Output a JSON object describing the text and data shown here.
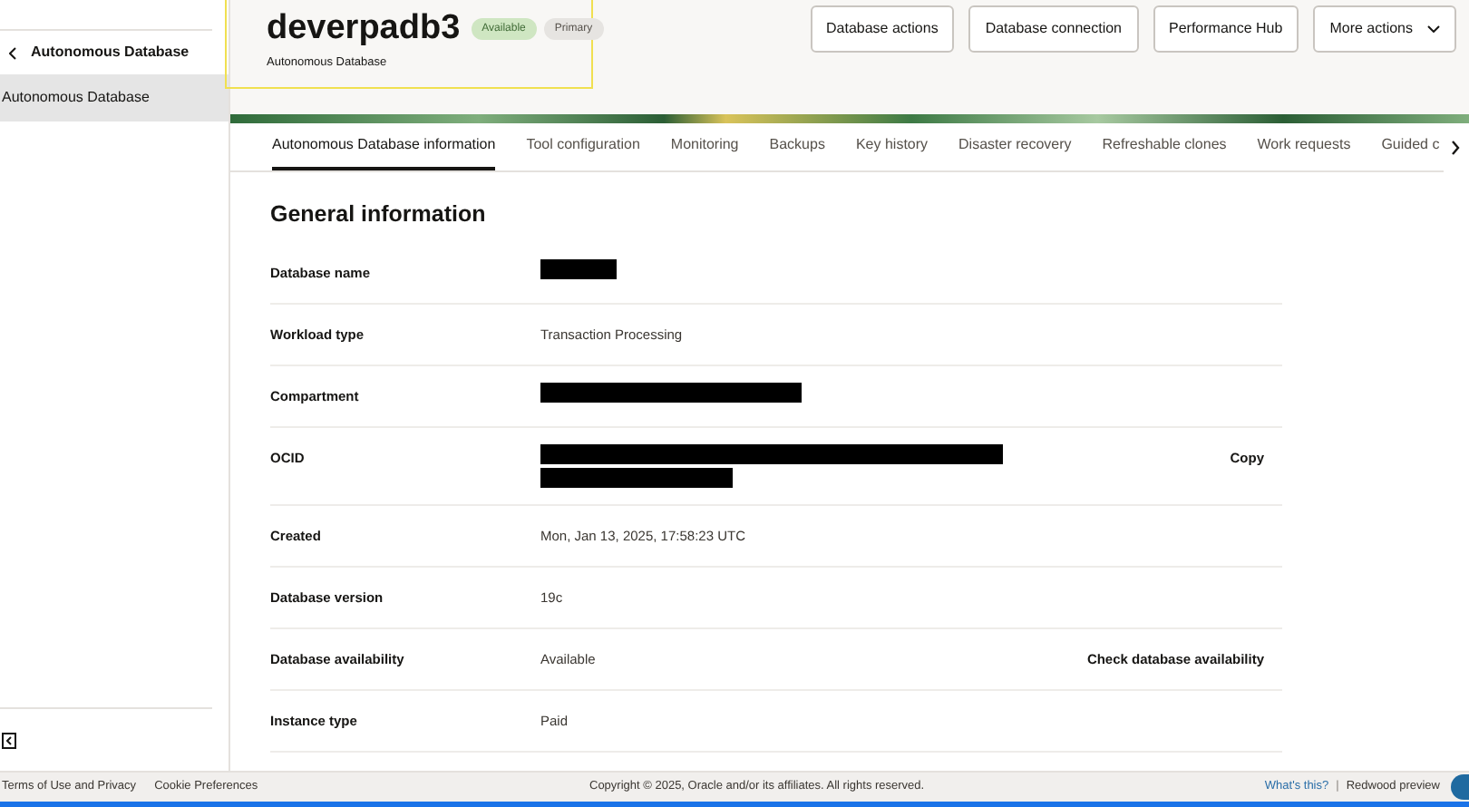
{
  "sidebar": {
    "back_label": "Autonomous Database",
    "items": [
      {
        "label": "Autonomous Database",
        "selected": true
      }
    ]
  },
  "header": {
    "title": "deverpadb3",
    "badges": [
      {
        "label": "Available",
        "kind": "status"
      },
      {
        "label": "Primary",
        "kind": "role"
      }
    ],
    "subtitle": "Autonomous Database",
    "actions": [
      {
        "label": "Database actions",
        "kind": "button"
      },
      {
        "label": "Database connection",
        "kind": "button"
      },
      {
        "label": "Performance Hub",
        "kind": "button"
      },
      {
        "label": "More actions",
        "kind": "menu"
      }
    ]
  },
  "tabs": [
    {
      "label": "Autonomous Database information",
      "selected": true
    },
    {
      "label": "Tool configuration",
      "selected": false
    },
    {
      "label": "Monitoring",
      "selected": false
    },
    {
      "label": "Backups",
      "selected": false
    },
    {
      "label": "Key history",
      "selected": false
    },
    {
      "label": "Disaster recovery",
      "selected": false
    },
    {
      "label": "Refreshable clones",
      "selected": false
    },
    {
      "label": "Work requests",
      "selected": false
    },
    {
      "label": "Guided c",
      "selected": false
    }
  ],
  "section": {
    "title": "General information",
    "rows": [
      {
        "label": "Database name",
        "kind": "redacted"
      },
      {
        "label": "Workload type",
        "kind": "text",
        "value": "Transaction Processing"
      },
      {
        "label": "Compartment",
        "kind": "redacted"
      },
      {
        "label": "OCID",
        "kind": "redacted",
        "action": "Copy"
      },
      {
        "label": "Created",
        "kind": "text",
        "value": "Mon, Jan 13, 2025, 17:58:23 UTC"
      },
      {
        "label": "Database version",
        "kind": "text",
        "value": "19c"
      },
      {
        "label": "Database availability",
        "kind": "text",
        "value": "Available",
        "action": "Check database availability"
      },
      {
        "label": "Instance type",
        "kind": "text",
        "value": "Paid"
      }
    ]
  },
  "footer": {
    "links": [
      "Terms of Use and Privacy",
      "Cookie Preferences"
    ],
    "copyright": "Copyright © 2025, Oracle and/or its affiliates. All rights reserved.",
    "help_link": "What's this?",
    "separator": "|",
    "preview_label": "Redwood preview",
    "preview_on": true
  }
}
